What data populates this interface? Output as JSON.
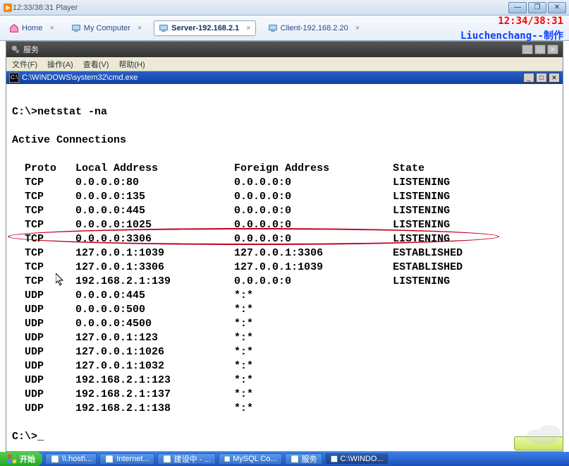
{
  "vm": {
    "title_time": "12:33/38:31",
    "title_app": "Player",
    "btn_min": "—",
    "btn_max": "❐",
    "btn_close": "✕"
  },
  "overlay": {
    "time": "12:34/38:31",
    "credit": "Liuchenchang--制作"
  },
  "tabs": [
    {
      "label": "Home",
      "icon": "home"
    },
    {
      "label": "My Computer",
      "icon": "computer"
    },
    {
      "label": "Server-192.168.2.1",
      "icon": "server",
      "active": true
    },
    {
      "label": "Client-192.168.2.20",
      "icon": "client"
    }
  ],
  "inner": {
    "title": "服务",
    "menu": [
      "文件(F)",
      "操作(A)",
      "查看(V)",
      "帮助(H)"
    ],
    "btn_min": "_",
    "btn_max": "□",
    "btn_close": "✕"
  },
  "cmd": {
    "title": "C:\\WINDOWS\\system32\\cmd.exe",
    "prompt1": "C:\\>netstat -na",
    "heading": "Active Connections",
    "col_proto": "Proto",
    "col_local": "Local Address",
    "col_foreign": "Foreign Address",
    "col_state": "State",
    "rows": [
      {
        "proto": "TCP",
        "local": "0.0.0.0:80",
        "foreign": "0.0.0.0:0",
        "state": "LISTENING"
      },
      {
        "proto": "TCP",
        "local": "0.0.0.0:135",
        "foreign": "0.0.0.0:0",
        "state": "LISTENING"
      },
      {
        "proto": "TCP",
        "local": "0.0.0.0:445",
        "foreign": "0.0.0.0:0",
        "state": "LISTENING"
      },
      {
        "proto": "TCP",
        "local": "0.0.0.0:1025",
        "foreign": "0.0.0.0:0",
        "state": "LISTENING"
      },
      {
        "proto": "TCP",
        "local": "0.0.0.0:3306",
        "foreign": "0.0.0.0:0",
        "state": "LISTENING",
        "highlight": true
      },
      {
        "proto": "TCP",
        "local": "127.0.0.1:1039",
        "foreign": "127.0.0.1:3306",
        "state": "ESTABLISHED"
      },
      {
        "proto": "TCP",
        "local": "127.0.0.1:3306",
        "foreign": "127.0.0.1:1039",
        "state": "ESTABLISHED"
      },
      {
        "proto": "TCP",
        "local": "192.168.2.1:139",
        "foreign": "0.0.0.0:0",
        "state": "LISTENING"
      },
      {
        "proto": "UDP",
        "local": "0.0.0.0:445",
        "foreign": "*:*",
        "state": ""
      },
      {
        "proto": "UDP",
        "local": "0.0.0.0:500",
        "foreign": "*:*",
        "state": ""
      },
      {
        "proto": "UDP",
        "local": "0.0.0.0:4500",
        "foreign": "*:*",
        "state": ""
      },
      {
        "proto": "UDP",
        "local": "127.0.0.1:123",
        "foreign": "*:*",
        "state": ""
      },
      {
        "proto": "UDP",
        "local": "127.0.0.1:1026",
        "foreign": "*:*",
        "state": ""
      },
      {
        "proto": "UDP",
        "local": "127.0.0.1:1032",
        "foreign": "*:*",
        "state": ""
      },
      {
        "proto": "UDP",
        "local": "192.168.2.1:123",
        "foreign": "*:*",
        "state": ""
      },
      {
        "proto": "UDP",
        "local": "192.168.2.1:137",
        "foreign": "*:*",
        "state": ""
      },
      {
        "proto": "UDP",
        "local": "192.168.2.1:138",
        "foreign": "*:*",
        "state": ""
      }
    ],
    "prompt2": "C:\\>_",
    "btn_min": "_",
    "btn_max": "□",
    "btn_close": "✕"
  },
  "taskbar": {
    "start": "开始",
    "items": [
      {
        "label": "\\\\.host\\..."
      },
      {
        "label": "Internet..."
      },
      {
        "label": "建设中 - ..."
      },
      {
        "label": "MySQL Co..."
      },
      {
        "label": "服务"
      },
      {
        "label": "C:\\WINDO...",
        "active": true
      }
    ]
  }
}
